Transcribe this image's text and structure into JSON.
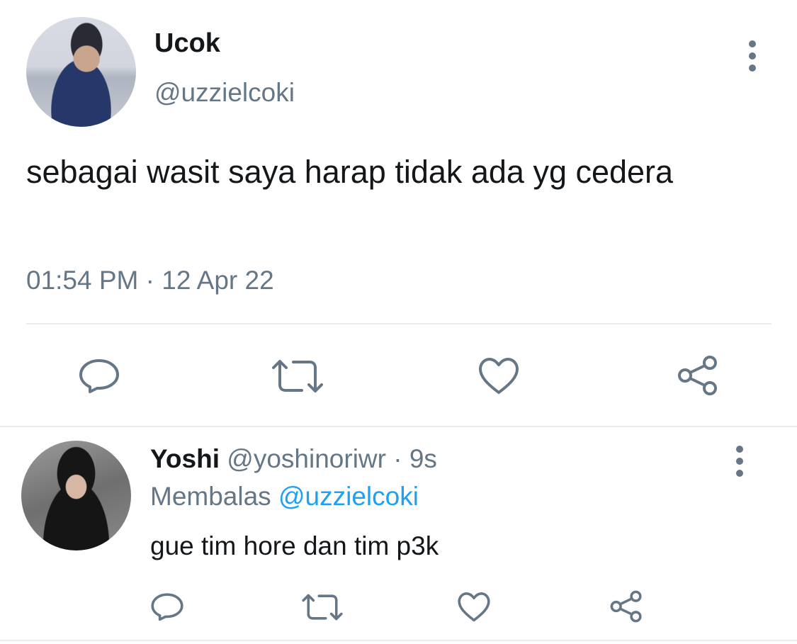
{
  "tweet": {
    "author_name": "Ucok",
    "author_handle": "@uzzielcoki",
    "text": "sebagai wasit saya harap tidak ada yg cedera",
    "timestamp": "01:54 PM · 12 Apr 22",
    "actions": [
      "reply-icon",
      "retweet-icon",
      "like-icon",
      "share-icon"
    ]
  },
  "reply": {
    "author_name": "Yoshi",
    "author_handle": "@yoshinoriwr",
    "separator": "·",
    "time_ago": "9s",
    "replying_label": "Membalas",
    "replying_to": "@uzzielcoki",
    "text": "gue tim hore dan tim p3k",
    "actions": [
      "reply-icon",
      "retweet-icon",
      "like-icon",
      "share-icon"
    ]
  },
  "colors": {
    "text_primary": "#14171a",
    "text_secondary": "#657786",
    "link": "#1da1f2",
    "divider": "#e6ecf0"
  }
}
